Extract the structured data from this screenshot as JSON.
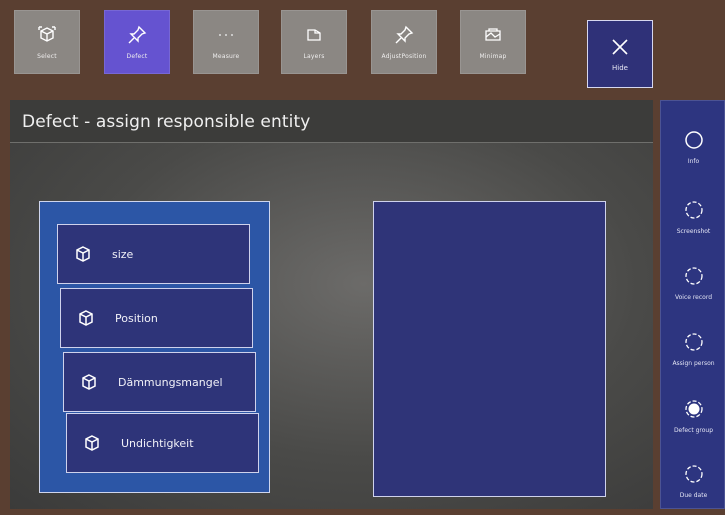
{
  "toolbar": {
    "items": [
      {
        "label": "Select",
        "icon": "select-cube-icon",
        "active": false
      },
      {
        "label": "Defect",
        "icon": "pin-icon",
        "active": true
      },
      {
        "label": "Measure",
        "icon": "dots-icon",
        "active": false
      },
      {
        "label": "Layers",
        "icon": "layers-icon",
        "active": false
      },
      {
        "label": "AdjustPosition",
        "icon": "pin-icon",
        "active": false
      },
      {
        "label": "Minimap",
        "icon": "map-icon",
        "active": false
      }
    ],
    "hide_label": "Hide"
  },
  "panel": {
    "title": "Defect - assign responsible entity"
  },
  "entity_list": {
    "items": [
      {
        "label": "size"
      },
      {
        "label": "Position"
      },
      {
        "label": "Dämmungsmangel"
      },
      {
        "label": "Undichtigkeit"
      }
    ]
  },
  "side_menu": {
    "items": [
      {
        "label": "Info",
        "icon": "circle-icon"
      },
      {
        "label": "Screenshot",
        "icon": "dashed-circle-icon"
      },
      {
        "label": "Voice record",
        "icon": "dashed-circle-icon"
      },
      {
        "label": "Assign person",
        "icon": "dashed-circle-icon"
      },
      {
        "label": "Defect group",
        "icon": "filled-dashed-circle-icon"
      },
      {
        "label": "Due date",
        "icon": "dashed-circle-icon"
      }
    ]
  },
  "colors": {
    "background": "#5a3f31",
    "toolbar_button": "#8b8783",
    "toolbar_active": "#6553d0",
    "list_panel": "#2c56a6",
    "item": "#2e3479",
    "side_panel": "#2d3580"
  }
}
